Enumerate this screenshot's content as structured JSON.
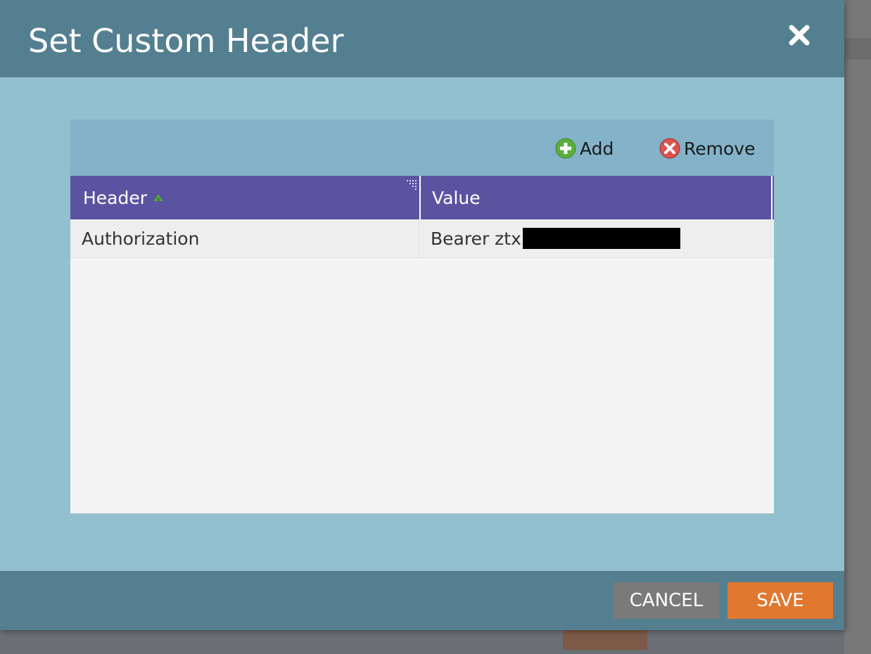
{
  "dialog": {
    "title": "Set Custom Header",
    "close_icon": "close-icon"
  },
  "toolbar": {
    "add_label": "Add",
    "add_icon": "plus-circle-icon",
    "remove_label": "Remove",
    "remove_icon": "remove-circle-icon"
  },
  "grid": {
    "columns": [
      {
        "label": "Header",
        "sorted": "ascending"
      },
      {
        "label": "Value"
      }
    ],
    "rows": [
      {
        "header": "Authorization",
        "value": "Bearer ztx"
      }
    ]
  },
  "footer": {
    "cancel_label": "CANCEL",
    "save_label": "SAVE"
  },
  "colors": {
    "title_bar": "#547f91",
    "dialog_body": "#92c0cf",
    "toolbar": "#83b2c9",
    "grid_header": "#5a54a0",
    "save_button": "#e0782f",
    "cancel_button": "#7a7a7a"
  }
}
